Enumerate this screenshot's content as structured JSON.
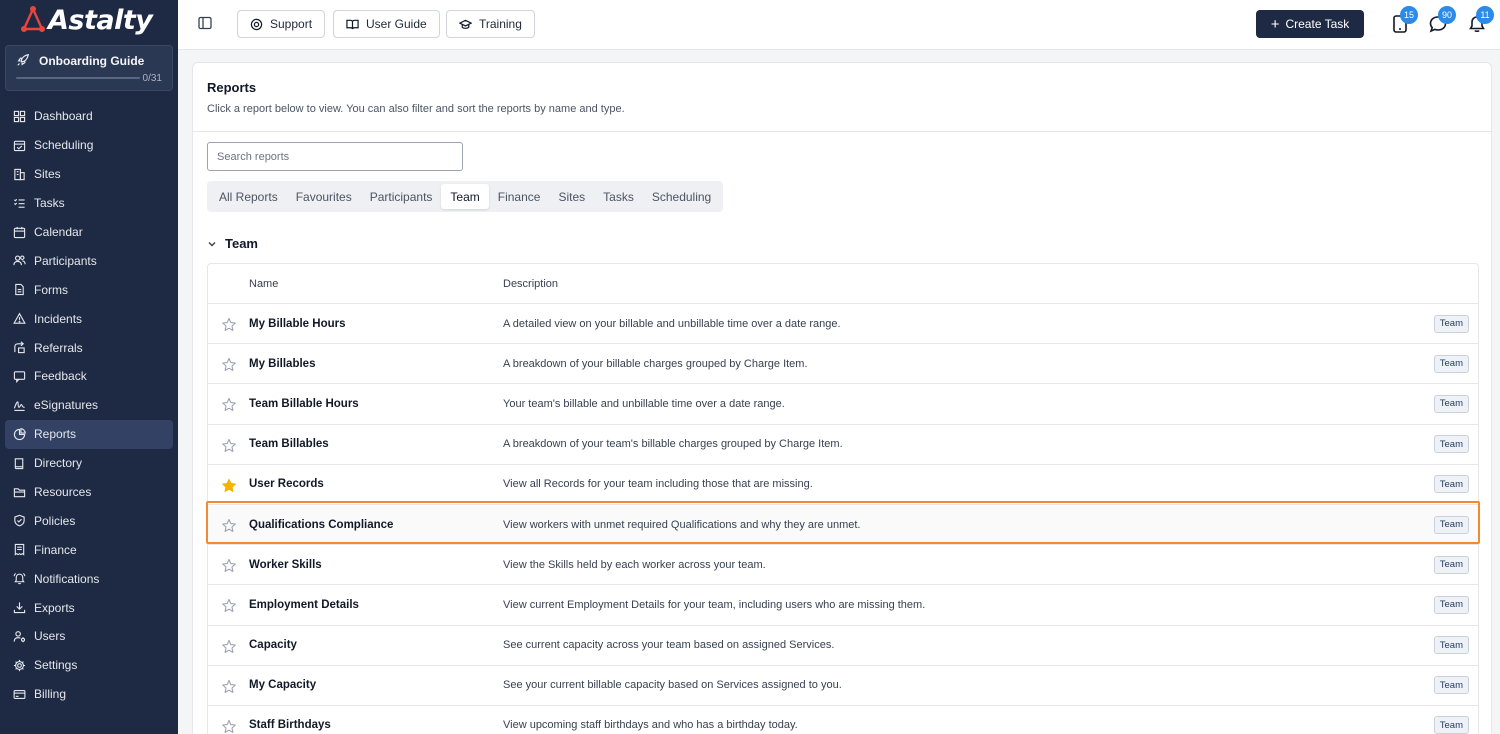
{
  "brand": {
    "name": "Astalty"
  },
  "onboarding": {
    "title": "Onboarding Guide",
    "progress": "0/31",
    "progress_fraction": 0
  },
  "sidebar": {
    "items": [
      {
        "label": "Dashboard",
        "icon": "grid-icon",
        "active": false
      },
      {
        "label": "Scheduling",
        "icon": "calendar-check-icon",
        "active": false
      },
      {
        "label": "Sites",
        "icon": "building-icon",
        "active": false
      },
      {
        "label": "Tasks",
        "icon": "list-check-icon",
        "active": false
      },
      {
        "label": "Calendar",
        "icon": "calendar-icon",
        "active": false
      },
      {
        "label": "Participants",
        "icon": "users-icon",
        "active": false
      },
      {
        "label": "Forms",
        "icon": "document-icon",
        "active": false
      },
      {
        "label": "Incidents",
        "icon": "warning-icon",
        "active": false
      },
      {
        "label": "Referrals",
        "icon": "referral-icon",
        "active": false
      },
      {
        "label": "Feedback",
        "icon": "message-icon",
        "active": false
      },
      {
        "label": "eSignatures",
        "icon": "signature-icon",
        "active": false
      },
      {
        "label": "Reports",
        "icon": "pie-chart-icon",
        "active": true
      },
      {
        "label": "Directory",
        "icon": "book-icon",
        "active": false
      },
      {
        "label": "Resources",
        "icon": "folder-icon",
        "active": false
      },
      {
        "label": "Policies",
        "icon": "shield-icon",
        "active": false
      },
      {
        "label": "Finance",
        "icon": "receipt-icon",
        "active": false
      },
      {
        "label": "Notifications",
        "icon": "bell-ring-icon",
        "active": false
      },
      {
        "label": "Exports",
        "icon": "download-icon",
        "active": false
      },
      {
        "label": "Users",
        "icon": "user-cog-icon",
        "active": false
      },
      {
        "label": "Settings",
        "icon": "gear-icon",
        "active": false
      },
      {
        "label": "Billing",
        "icon": "credit-card-icon",
        "active": false
      }
    ]
  },
  "topbar": {
    "support_label": "Support",
    "user_guide_label": "User Guide",
    "training_label": "Training",
    "create_task_label": "Create Task",
    "badges": {
      "tablet": "15",
      "messages": "90",
      "notifications": "11"
    }
  },
  "page": {
    "title": "Reports",
    "subtitle": "Click a report below to view. You can also filter and sort the reports by name and type.",
    "search_placeholder": "Search reports",
    "tabs": [
      "All Reports",
      "Favourites",
      "Participants",
      "Team",
      "Finance",
      "Sites",
      "Tasks",
      "Scheduling"
    ],
    "active_tab": "Team",
    "section_title": "Team"
  },
  "table": {
    "columns": {
      "name": "Name",
      "description": "Description"
    },
    "rows": [
      {
        "name": "My Billable Hours",
        "description": "A detailed view on your billable and unbillable time over a date range.",
        "tag": "Team",
        "favourite": false
      },
      {
        "name": "My Billables",
        "description": "A breakdown of your billable charges grouped by Charge Item.",
        "tag": "Team",
        "favourite": false
      },
      {
        "name": "Team Billable Hours",
        "description": "Your team's billable and unbillable time over a date range.",
        "tag": "Team",
        "favourite": false
      },
      {
        "name": "Team Billables",
        "description": "A breakdown of your team's billable charges grouped by Charge Item.",
        "tag": "Team",
        "favourite": false
      },
      {
        "name": "User Records",
        "description": "View all Records for your team including those that are missing.",
        "tag": "Team",
        "favourite": true
      },
      {
        "name": "Qualifications Compliance",
        "description": "View workers with unmet required Qualifications and why they are unmet.",
        "tag": "Team",
        "favourite": false,
        "highlighted": true
      },
      {
        "name": "Worker Skills",
        "description": "View the Skills held by each worker across your team.",
        "tag": "Team",
        "favourite": false
      },
      {
        "name": "Employment Details",
        "description": "View current Employment Details for your team, including users who are missing them.",
        "tag": "Team",
        "favourite": false
      },
      {
        "name": "Capacity",
        "description": "See current capacity across your team based on assigned Services.",
        "tag": "Team",
        "favourite": false
      },
      {
        "name": "My Capacity",
        "description": "See your current billable capacity based on Services assigned to you.",
        "tag": "Team",
        "favourite": false
      },
      {
        "name": "Staff Birthdays",
        "description": "View upcoming staff birthdays and who has a birthday today.",
        "tag": "Team",
        "favourite": false
      }
    ]
  },
  "colors": {
    "sidebar_bg": "#1e2a44",
    "accent": "#2b8be6",
    "highlight_border": "#f28b30",
    "favourite_star": "#f5b301",
    "logo_mark": "#e8453c"
  }
}
